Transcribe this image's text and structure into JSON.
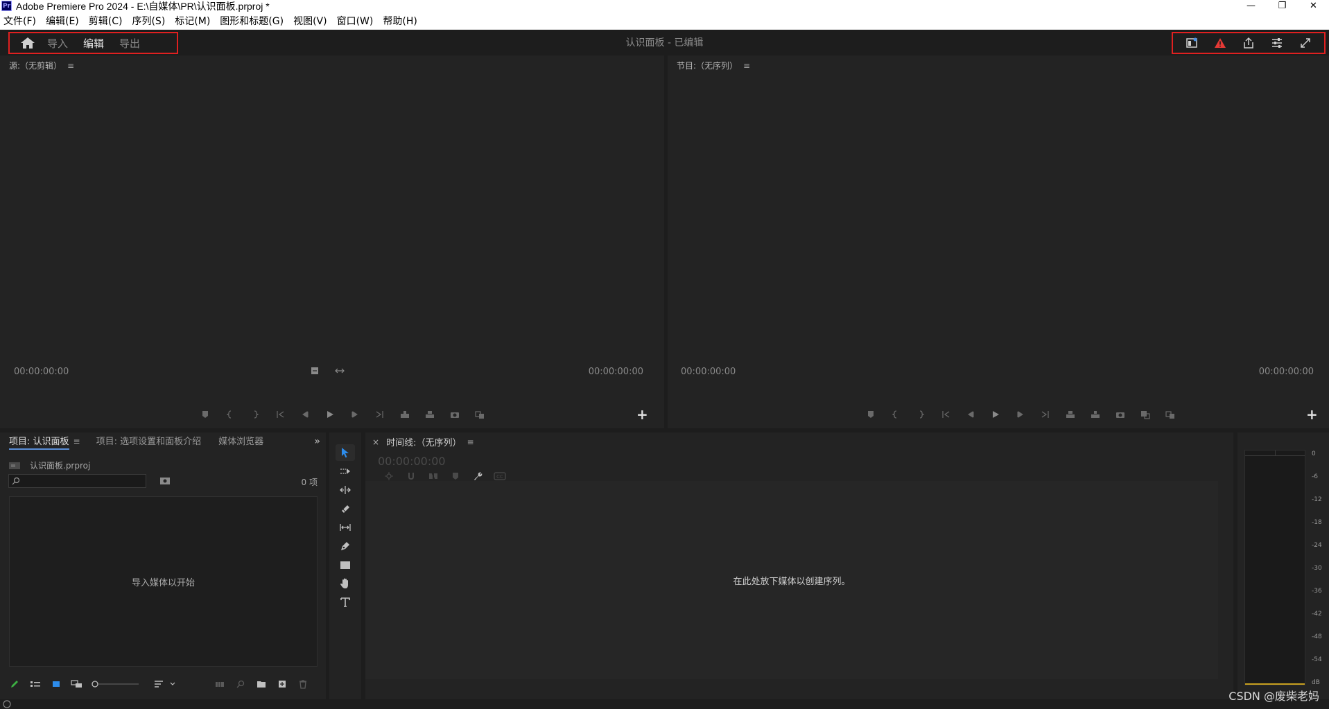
{
  "app": {
    "logo": "Pr",
    "window_title": "Adobe Premiere Pro 2024 - E:\\自媒体\\PR\\认识面板.prproj *"
  },
  "window_controls": {
    "minimize": "—",
    "restore": "❐",
    "close": "✕"
  },
  "menu": [
    "文件(F)",
    "编辑(E)",
    "剪辑(C)",
    "序列(S)",
    "标记(M)",
    "图形和标题(G)",
    "视图(V)",
    "窗口(W)",
    "帮助(H)"
  ],
  "workspace": {
    "tabs": [
      "导入",
      "编辑",
      "导出"
    ],
    "active_tab": "编辑",
    "title": "认识面板 - 已编辑",
    "accent_color": "#e02020"
  },
  "source_monitor": {
    "title": "源:（无剪辑）",
    "timecode_left": "00:00:00:00",
    "timecode_right": "00:00:00:00"
  },
  "program_monitor": {
    "title": "节目:（无序列）",
    "timecode_left": "00:00:00:00",
    "timecode_right": "00:00:00:00"
  },
  "project_panel": {
    "tabs": [
      "项目: 认识面板",
      "项目: 选项设置和面板介绍",
      "媒体浏览器"
    ],
    "file_name": "认识面板.prproj",
    "item_count": "0 项",
    "empty_message": "导入媒体以开始"
  },
  "timeline": {
    "close_glyph": "×",
    "title": "时间线:（无序列）",
    "timecode": "00:00:00:00",
    "empty_message": "在此处放下媒体以创建序列。"
  },
  "audio_meter": {
    "scale": [
      "0",
      "-6",
      "-12",
      "-18",
      "-24",
      "-30",
      "-36",
      "-42",
      "-48",
      "-54",
      "dB"
    ]
  },
  "watermark": "CSDN @废柴老妈"
}
